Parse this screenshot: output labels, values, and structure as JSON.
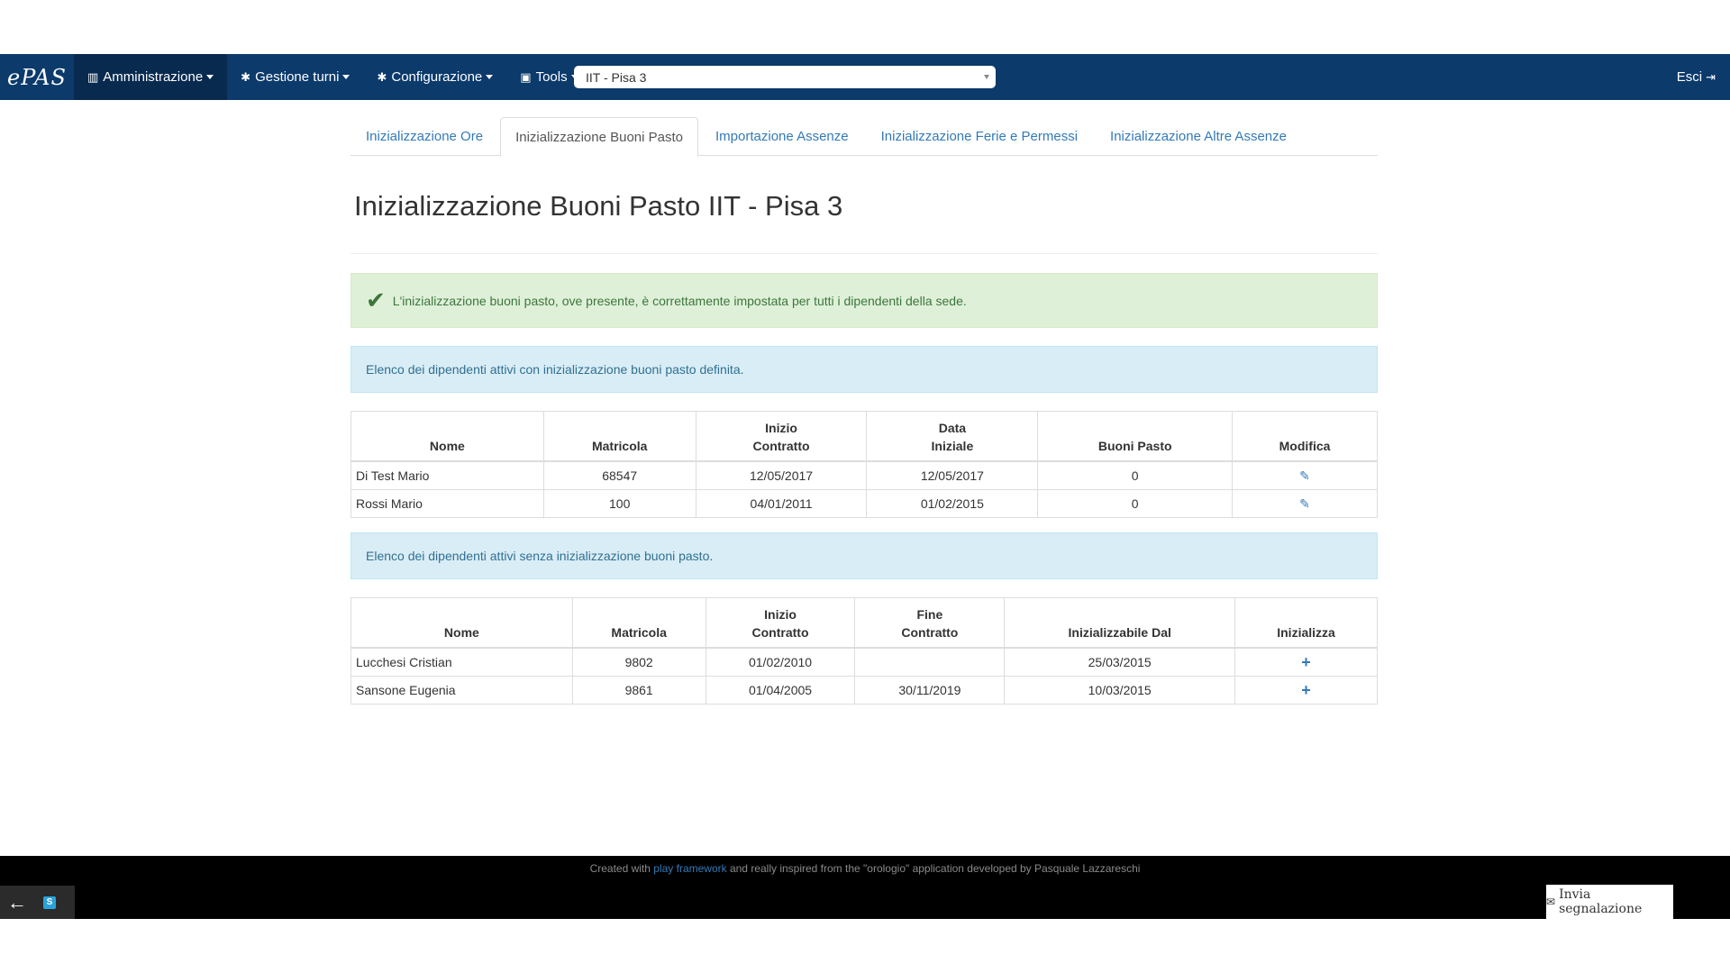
{
  "navbar": {
    "brand": "ePAS",
    "menus": [
      {
        "label": "Amministrazione",
        "icon": "bar-chart-icon",
        "glyph": "▥"
      },
      {
        "label": "Gestione turni",
        "icon": "gear-icon",
        "glyph": "✱"
      },
      {
        "label": "Configurazione",
        "icon": "gear-icon",
        "glyph": "✱"
      },
      {
        "label": "Tools",
        "icon": "toolbox-icon",
        "glyph": "▣"
      }
    ],
    "office_select": "IIT - Pisa 3",
    "logout": "Esci",
    "logout_glyph": "⇥"
  },
  "tabs": [
    "Inizializzazione Ore",
    "Inizializzazione Buoni Pasto",
    "Importazione Assenze",
    "Inizializzazione Ferie e Permessi",
    "Inizializzazione Altre Assenze"
  ],
  "title": "Inizializzazione Buoni Pasto IIT - Pisa 3",
  "alerts": {
    "success": "L'inizializzazione buoni pasto, ove presente, è correttamente impostata per tutti i dipendenti della sede.",
    "with_init": "Elenco dei dipendenti attivi con inizializzazione buoni pasto definita.",
    "without_init": "Elenco dei dipendenti attivi senza inizializzazione buoni pasto."
  },
  "table_with": {
    "headers": [
      "Nome",
      "Matricola",
      "Inizio\nContratto",
      "Data\nIniziale",
      "Buoni Pasto",
      "Modifica"
    ],
    "rows": [
      [
        "Di Test Mario",
        "68547",
        "12/05/2017",
        "12/05/2017",
        "0"
      ],
      [
        "Rossi Mario",
        "100",
        "04/01/2011",
        "01/02/2015",
        "0"
      ]
    ],
    "edit_glyph": "✎"
  },
  "table_without": {
    "headers": [
      "Nome",
      "Matricola",
      "Inizio\nContratto",
      "Fine\nContratto",
      "Inizializzabile Dal",
      "Inizializza"
    ],
    "rows": [
      [
        "Lucchesi Cristian",
        "9802",
        "01/02/2010",
        "",
        "25/03/2015"
      ],
      [
        "Sansone Eugenia",
        "9861",
        "01/04/2005",
        "30/11/2019",
        "10/03/2015"
      ]
    ],
    "add_glyph": "+"
  },
  "footer": {
    "prefix": "Created with ",
    "link": "play framework",
    "suffix": " and really inspired from the \"orologio\" application developed by Pasquale Lazzareschi",
    "report_button": "Invia segnalazione",
    "report_glyph": "✉",
    "back_glyph": "←",
    "badge": "S"
  },
  "colors": {
    "navbar": "#0b3a6b",
    "link": "#337ab7",
    "success_bg": "#dff0d8",
    "info_bg": "#d9edf7"
  }
}
